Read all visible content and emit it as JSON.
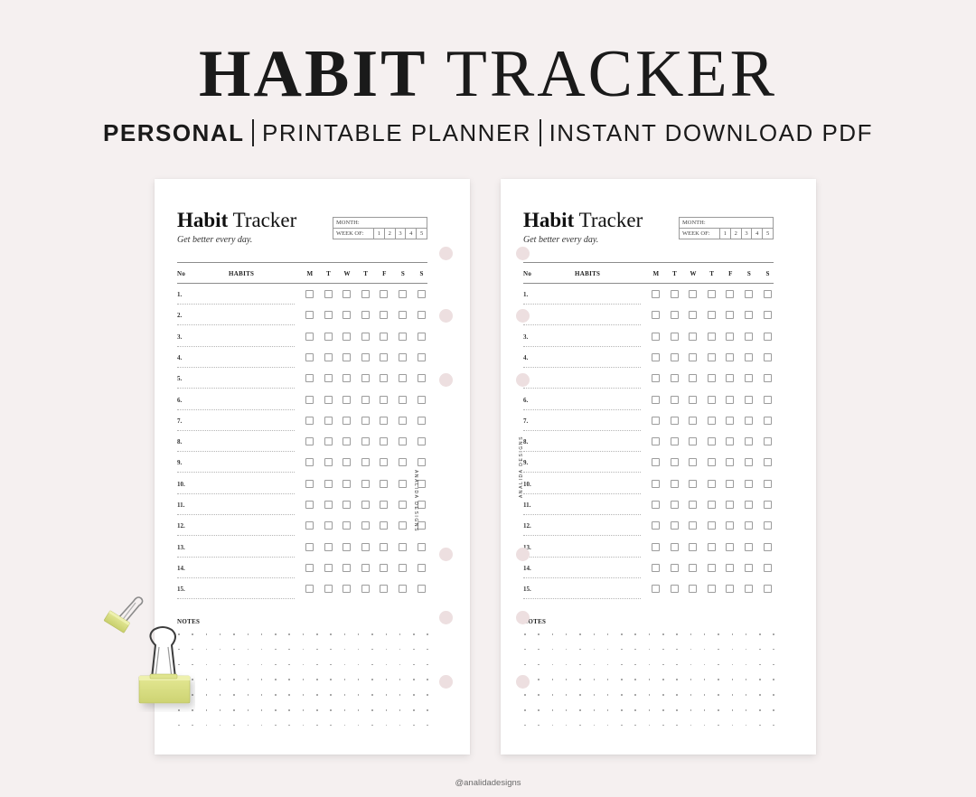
{
  "hero": {
    "title_bold": "HABIT",
    "title_regular": "TRACKER",
    "subtitle_strong": "PERSONAL",
    "subtitle_parts": [
      "PRINTABLE PLANNER",
      "INSTANT DOWNLOAD PDF"
    ]
  },
  "sheet": {
    "title_bold": "Habit",
    "title_regular": "Tracker",
    "tagline": "Get better every day.",
    "month_label": "MONTH:",
    "week_label": "WEEK OF:",
    "weeks": [
      "1",
      "2",
      "3",
      "4",
      "5"
    ],
    "columns": {
      "no": "No",
      "habits": "HABITS",
      "days": [
        "M",
        "T",
        "W",
        "T",
        "F",
        "S",
        "S"
      ]
    },
    "rows": [
      "1.",
      "2.",
      "3.",
      "4.",
      "5.",
      "6.",
      "7.",
      "8.",
      "9.",
      "10.",
      "11.",
      "12.",
      "13.",
      "14.",
      "15."
    ],
    "notes_label": "NOTES",
    "brand": "ANALIDA DESIGNS"
  },
  "footer": {
    "handle": "@analidadesigns"
  },
  "colors": {
    "background": "#f5f0f0",
    "page": "#ffffff",
    "hole": "#eddfe0",
    "clip": "#d9df83",
    "ink": "#1a1a1a"
  }
}
